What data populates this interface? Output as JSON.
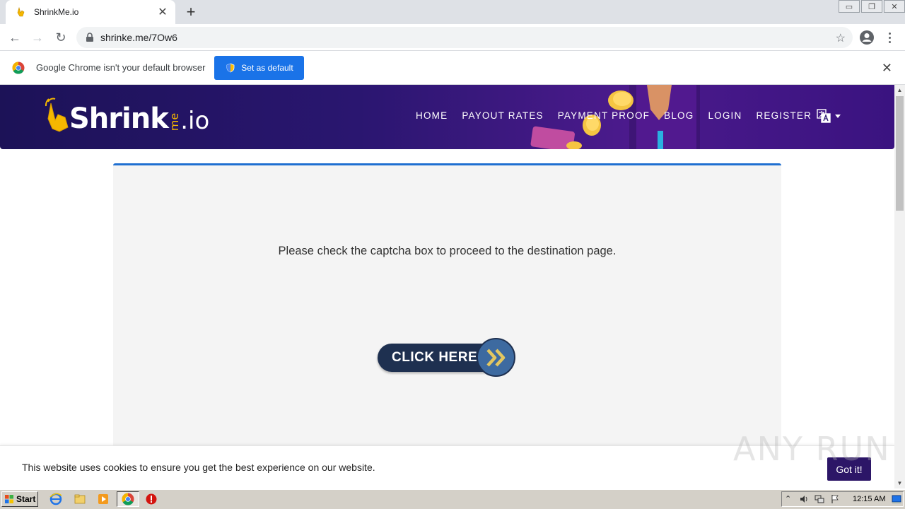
{
  "browser": {
    "tab_title": "ShrinkMe.io",
    "url": "shrinke.me/7Ow6"
  },
  "infobar": {
    "message": "Google Chrome isn't your default browser",
    "button_label": "Set as default"
  },
  "site": {
    "logo_text": "Shrink",
    "logo_me": "me",
    "logo_io": ".io",
    "nav": [
      "HOME",
      "PAYOUT RATES",
      "PAYMENT PROOF",
      "BLOG",
      "LOGIN",
      "REGISTER"
    ]
  },
  "content": {
    "instruction": "Please check the captcha box to proceed to the destination page.",
    "click_button_label": "CLICK HERE"
  },
  "cookie": {
    "message": "This website uses cookies to ensure you get the best experience on our website.",
    "button_label": "Got it!"
  },
  "watermark": "ANY RUN",
  "taskbar": {
    "start_label": "Start",
    "clock": "12:15 AM"
  },
  "colors": {
    "header_bg": "#2a1670",
    "accent_blue": "#1f6fd1",
    "click_pill": "#1e3050",
    "gotit_bg": "#2c1667",
    "chrome_blue": "#1a73e8"
  },
  "icons": [
    "hand-pointer-icon",
    "lock-icon",
    "star-icon",
    "profile-icon",
    "chrome-logo-icon",
    "shield-icon",
    "translate-icon",
    "double-chevron-icon"
  ]
}
